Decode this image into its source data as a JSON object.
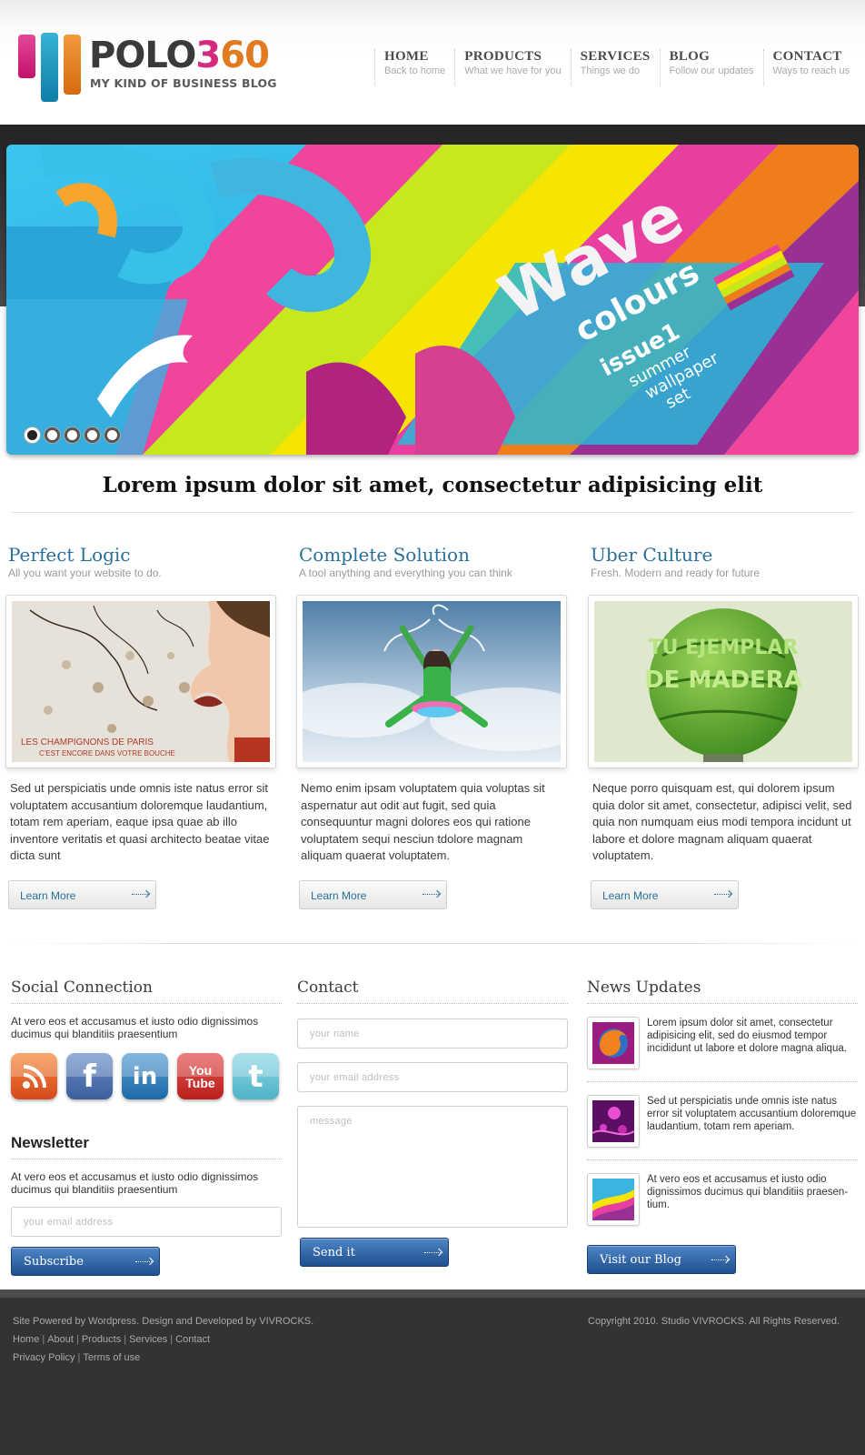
{
  "brand": {
    "name_a": "POLO",
    "name_b": "3",
    "name_c": "60",
    "tagline": "MY KIND OF BUSINESS BLOG",
    "colors": {
      "pink": "#d42a7d",
      "blue": "#1d8fbf",
      "orange": "#e27a20",
      "link_blue": "#2a6f9a",
      "button_blue": "#2f64a6"
    }
  },
  "nav": [
    {
      "label": "HOME",
      "sub": "Back to home"
    },
    {
      "label": "PRODUCTS",
      "sub": "What we have for you"
    },
    {
      "label": "SERVICES",
      "sub": "Things we do"
    },
    {
      "label": "BLOG",
      "sub": "Follow our updates"
    },
    {
      "label": "CONTACT",
      "sub": "Ways to reach us"
    }
  ],
  "slider": {
    "word1": "Wave",
    "word2": "colours",
    "issue": "issue1",
    "line1": "summer",
    "line2": "wallpaper",
    "line3": "set",
    "slide_count": 5,
    "active_slide": 1
  },
  "headline": "Lorem ipsum dolor sit amet, consectetur adipisicing elit",
  "features": [
    {
      "title": "Perfect Logic",
      "subtitle": "All you want your website to do.",
      "image_caption": "LES CHAMPIGNONS DE PARIS C'EST ENCORE DANS VOTRE BOUCHE",
      "body": "Sed ut perspiciatis unde omnis iste natus error sit voluptatem accusantium doloremque laudantium, totam rem aperiam, eaque ipsa quae ab illo inventore veritatis et quasi architecto beatae vitae dicta sunt",
      "button": "Learn More"
    },
    {
      "title": "Complete Solution",
      "subtitle": "A tool anything and everything you can think",
      "body": "Nemo enim ipsam voluptatem quia voluptas sit aspernatur aut odit aut fugit, sed quia consequuntur magni dolores eos qui ratione voluptatem sequi nesciun tdolore magnam aliquam quaerat voluptatem.",
      "button": "Learn More"
    },
    {
      "title": "Uber Culture",
      "subtitle": "Fresh. Modern and ready for future",
      "image_text": "TU EJEMPLAR DE MADERA",
      "body": "Neque porro quisquam est, qui dolorem ipsum quia dolor sit amet, consectetur, adipisci velit, sed quia non numquam eius modi tempora incidunt ut labore et dolore magnam aliquam quaerat voluptatem.",
      "button": "Learn More"
    }
  ],
  "social": {
    "title": "Social Connection",
    "text": "At vero eos et accusamus et iusto odio dignissimos ducimus qui blanditiis praesentium",
    "icons": [
      "rss-icon",
      "facebook-icon",
      "linkedin-icon",
      "youtube-icon",
      "twitter-icon"
    ],
    "fb_glyph": "f",
    "li_glyph": "in",
    "yt_glyph_1": "You",
    "yt_glyph_2": "Tube",
    "tw_glyph": "t"
  },
  "newsletter": {
    "title": "Newsletter",
    "text": "At vero eos et accusamus et iusto odio dignissimos ducimus qui blanditiis praesentium",
    "email_placeholder": "your email address",
    "button": "Subscribe"
  },
  "contact": {
    "title": "Contact",
    "name_placeholder": "your name",
    "email_placeholder": "your email address",
    "message_placeholder": "message",
    "button": "Send it"
  },
  "news": {
    "title": "News Updates",
    "items": [
      {
        "text": "Lorem ipsum dolor sit amet, consectetur adipisicing elit, sed do eiusmod tempor incididunt ut labore et dolore magna aliqua."
      },
      {
        "text": "Sed ut perspiciatis unde omnis iste natus error sit voluptatem accusantium doloremque laudantium, totam rem aperiam."
      },
      {
        "text": "At vero eos et accusamus et iusto odio dignissimos ducimus qui blanditiis praesen-tium."
      }
    ],
    "button": "Visit our Blog"
  },
  "footer": {
    "credits": "Site Powered by Wordpress. Design and Developed by VIVROCKS.",
    "links1": [
      "Home",
      "About",
      "Products",
      "Services",
      "Contact"
    ],
    "links2": [
      "Privacy Policy",
      "Terms of use"
    ],
    "separator": "|",
    "copyright": "Copyright 2010. Studio VIVROCKS. All Rights Reserved."
  }
}
